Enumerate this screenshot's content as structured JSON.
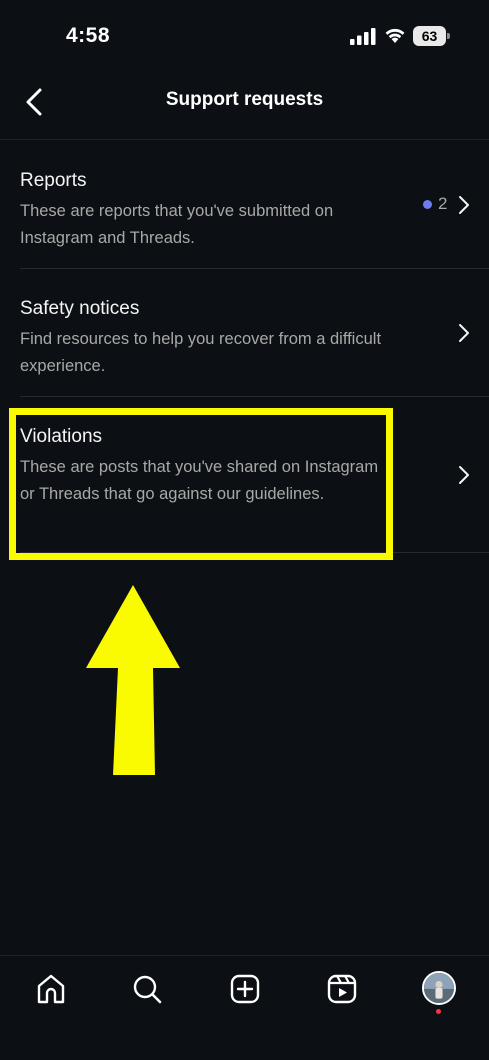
{
  "status_bar": {
    "time": "4:58",
    "battery_level": "63",
    "icons": [
      "signal-icon",
      "wifi-icon",
      "battery-icon"
    ]
  },
  "header": {
    "title": "Support requests",
    "back_icon": "chevron-left-icon"
  },
  "items": [
    {
      "title": "Reports",
      "description": "These are reports that you've submitted on Instagram and Threads.",
      "badge_count": "2",
      "badge_color": "#6d7cf2"
    },
    {
      "title": "Safety notices",
      "description": "Find resources to help you recover from a difficult experience."
    },
    {
      "title": "Violations",
      "description": "These are posts that you've shared on Instagram or Threads that go against our guidelines."
    }
  ],
  "annotation": {
    "color": "#fafa00",
    "shapes": [
      "highlight-box",
      "up-arrow"
    ]
  },
  "bottom_nav": {
    "items": [
      "home-icon",
      "search-icon",
      "create-icon",
      "reels-icon",
      "profile-avatar"
    ],
    "notification_dot_color": "#ff3040"
  },
  "colors": {
    "background": "#0c1014",
    "primary_text": "#f5f5f5",
    "secondary_text": "#a8a8a8"
  }
}
